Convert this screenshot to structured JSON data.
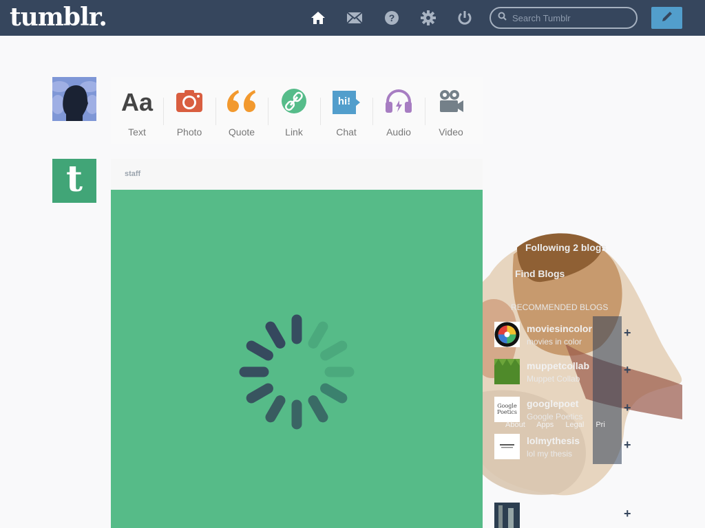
{
  "header": {
    "logo": "tumblr.",
    "search": {
      "placeholder": "Search Tumblr"
    },
    "nav": [
      "home-icon",
      "mail-icon",
      "help-icon",
      "settings-icon",
      "power-icon"
    ],
    "compose_icon": "pencil-icon",
    "bg_color": "#36465d",
    "accent_color": "#529ecc"
  },
  "post_types": [
    {
      "label": "Text",
      "icon": "Aa",
      "color": "#444444"
    },
    {
      "label": "Photo",
      "icon": "camera-icon",
      "color": "#d95e40"
    },
    {
      "label": "Quote",
      "icon": "quote-icon",
      "color": "#f2992e"
    },
    {
      "label": "Link",
      "icon": "link-icon",
      "color": "#56bc8a"
    },
    {
      "label": "Chat",
      "icon": "hi!",
      "color": "#529ecc"
    },
    {
      "label": "Audio",
      "icon": "headphones-icon",
      "color": "#a77dc2"
    },
    {
      "label": "Video",
      "icon": "video-camera-icon",
      "color": "#748089"
    }
  ],
  "post": {
    "author": "staff",
    "media_color": "#56bb88"
  },
  "sidebar": {
    "following": "Following 2 blogs",
    "find_blogs": "Find Blogs",
    "recommended_heading": "RECOMMENDED BLOGS",
    "recommended": [
      {
        "name": "moviesincolor",
        "subtitle": "movies in color"
      },
      {
        "name": "muppetcollab",
        "subtitle": "Muppet Collab"
      },
      {
        "name": "googlepoet",
        "subtitle": "Google Poetics"
      },
      {
        "name": "lolmythesis",
        "subtitle": "lol my thesis"
      }
    ],
    "footer_links": [
      "About",
      "Apps",
      "Legal",
      "Pri"
    ],
    "thumb_googlepoet": "Google Poetics"
  }
}
